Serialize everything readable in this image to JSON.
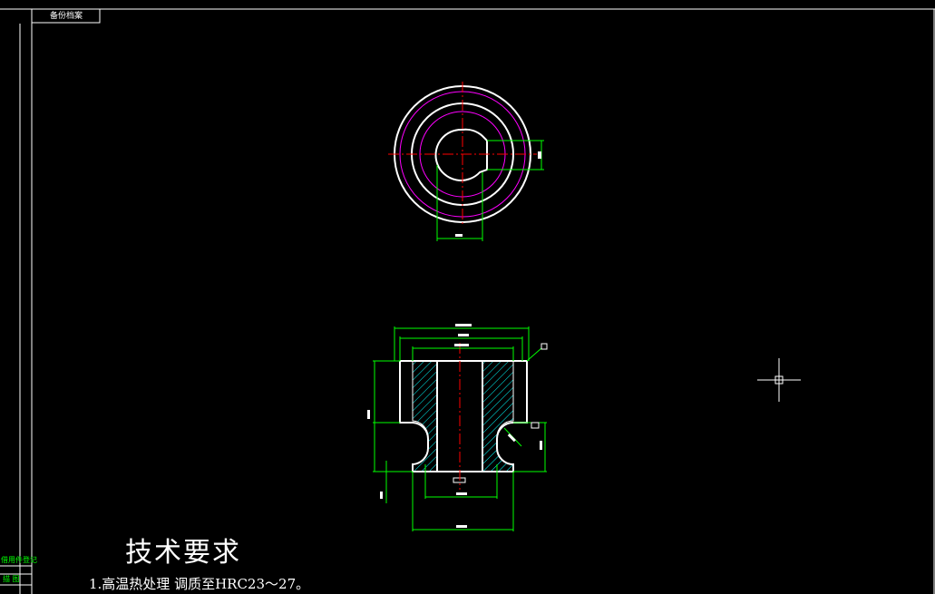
{
  "title_block": {
    "stamp_label": "备份档案",
    "side_label_1": "借用件登记",
    "side_label_2": "描 图"
  },
  "technical_requirements": {
    "heading": "技术要求",
    "items": [
      "1.高温热处理 调质至HRC23～27。"
    ]
  },
  "colors": {
    "background": "#000000",
    "outline": "#ffffff",
    "centerline": "#ff0000",
    "hidden_circle": "#ff00ff",
    "dimension": "#00ff00",
    "hatch": "#00ffff"
  },
  "icons": {
    "cursor": "crosshair-cursor-icon"
  }
}
